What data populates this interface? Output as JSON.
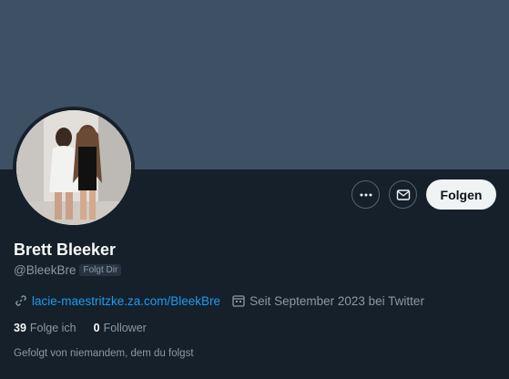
{
  "profile": {
    "name": "Brett Bleeker",
    "handle": "@BleekBre",
    "follows_you_badge": "Folgt Dir",
    "link": "lacie-maestritzke.za.com/BleekBre",
    "joined": "Seit September 2023 bei Twitter",
    "following_count": "39",
    "following_label": "Folge ich",
    "followers_count": "0",
    "followers_label": "Follower",
    "known_followers": "Gefolgt von niemandem, dem du folgst"
  },
  "actions": {
    "more_icon": "more-horizontal-icon",
    "message_icon": "envelope-icon",
    "follow_label": "Folgen"
  },
  "colors": {
    "background": "#15202b",
    "banner": "#3e5063",
    "link": "#1d9bf0",
    "muted_text": "#8b98a5"
  }
}
